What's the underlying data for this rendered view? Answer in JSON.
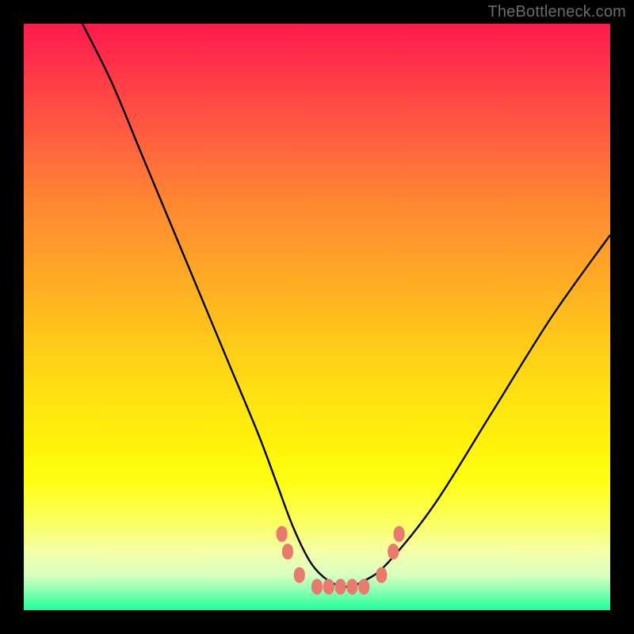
{
  "watermark": "TheBottleneck.com",
  "chart_data": {
    "type": "line",
    "title": "",
    "xlabel": "",
    "ylabel": "",
    "xlim": [
      0,
      100
    ],
    "ylim": [
      0,
      100
    ],
    "grid": false,
    "background": "heat-gradient",
    "background_stops": [
      {
        "pos": 0,
        "color": "#ff1a4d"
      },
      {
        "pos": 50,
        "color": "#ffc020"
      },
      {
        "pos": 80,
        "color": "#ffff30"
      },
      {
        "pos": 100,
        "color": "#1cff97"
      }
    ],
    "series": [
      {
        "name": "bottleneck-curve",
        "type": "line",
        "x": [
          10,
          15,
          20,
          25,
          30,
          35,
          40,
          43,
          46,
          49,
          52,
          55,
          58,
          62,
          70,
          80,
          90,
          100
        ],
        "y": [
          100,
          90,
          78,
          66,
          54,
          42,
          30,
          22,
          14,
          8,
          5,
          4,
          5,
          8,
          18,
          34,
          50,
          64
        ],
        "color": "#000000"
      }
    ],
    "markers": {
      "color": "#e97a6e",
      "shape": "rounded-rect",
      "points": [
        {
          "x": 44,
          "y": 13
        },
        {
          "x": 45,
          "y": 10
        },
        {
          "x": 47,
          "y": 6
        },
        {
          "x": 50,
          "y": 4
        },
        {
          "x": 52,
          "y": 4
        },
        {
          "x": 54,
          "y": 4
        },
        {
          "x": 56,
          "y": 4
        },
        {
          "x": 58,
          "y": 4
        },
        {
          "x": 61,
          "y": 6
        },
        {
          "x": 63,
          "y": 10
        },
        {
          "x": 64,
          "y": 13
        }
      ]
    }
  }
}
